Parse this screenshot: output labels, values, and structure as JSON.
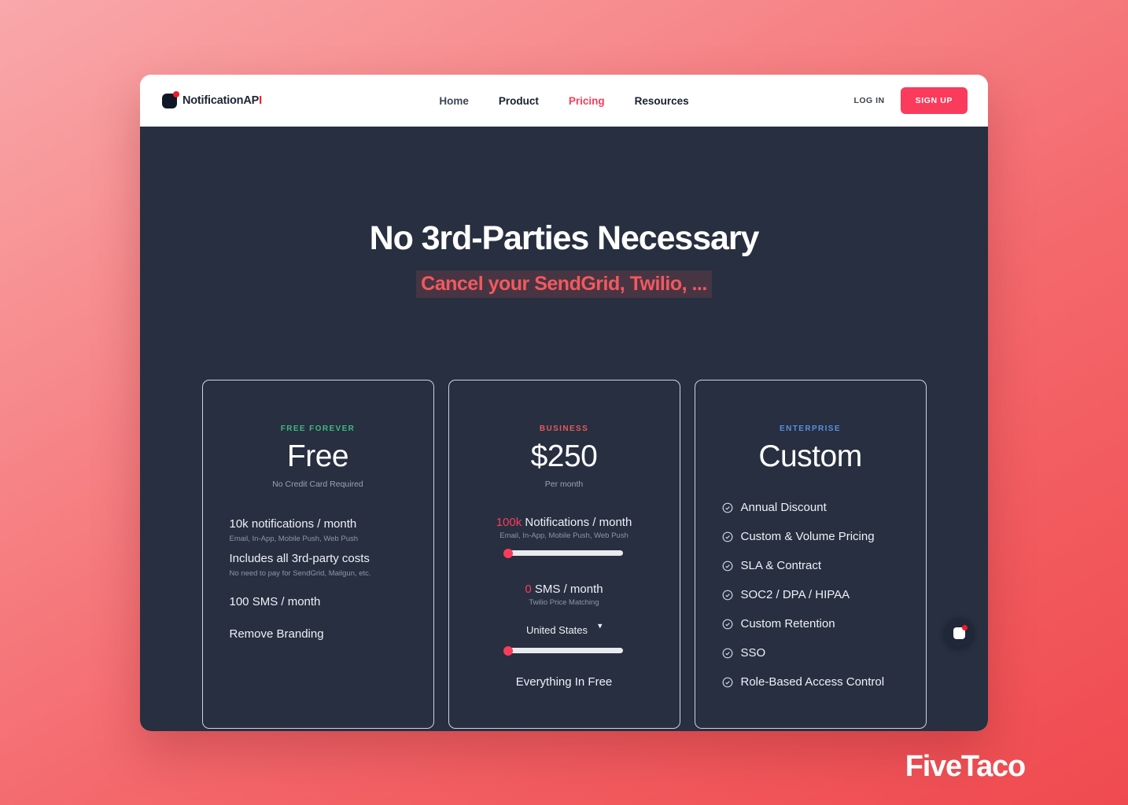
{
  "brand": {
    "name_main": "NotificationAP",
    "name_accent": "I",
    "logo_icon": "notification-square-icon"
  },
  "nav": {
    "links": [
      {
        "label": "Home",
        "state": "muted"
      },
      {
        "label": "Product",
        "state": "default"
      },
      {
        "label": "Pricing",
        "state": "active"
      },
      {
        "label": "Resources",
        "state": "default"
      }
    ],
    "login_label": "LOG IN",
    "signup_label": "SIGN UP"
  },
  "hero": {
    "title": "No 3rd-Parties Necessary",
    "subtitle": "Cancel your SendGrid, Twilio, ..."
  },
  "plans": {
    "free": {
      "tag": "FREE FOREVER",
      "price": "Free",
      "note": "No Credit Card Required",
      "features": [
        {
          "title": "10k notifications / month",
          "sub": "Email, In-App, Mobile Push, Web Push"
        },
        {
          "title": "Includes all 3rd-party costs",
          "sub": "No need to pay for SendGrid, Mailgun, etc."
        },
        {
          "title": "100 SMS / month",
          "sub": ""
        },
        {
          "title": "Remove Branding",
          "sub": ""
        }
      ]
    },
    "business": {
      "tag": "BUSINESS",
      "price": "$250",
      "note": "Per month",
      "notifications_amount": "100k",
      "notifications_label": " Notifications / month",
      "notifications_sub": "Email, In-App, Mobile Push, Web Push",
      "sms_amount": "0",
      "sms_label": " SMS / month",
      "sms_sub": "Twilio Price Matching",
      "country_selected": "United States",
      "country_options": [
        "United States"
      ],
      "footer": "Everything In Free",
      "slider_chevron": "chevron-down-icon"
    },
    "enterprise": {
      "tag": "ENTERPRISE",
      "price": "Custom",
      "features": [
        "Annual Discount",
        "Custom & Volume Pricing",
        "SLA & Contract",
        "SOC2 / DPA / HIPAA",
        "Custom Retention",
        "SSO",
        "Role-Based Access Control"
      ]
    }
  },
  "widget": {
    "icon": "notification-bell-widget-icon"
  },
  "watermark": {
    "text": "FiveTaco"
  },
  "colors": {
    "accent_pink": "#fb3b5c",
    "page_dark": "#272f40",
    "green": "#3fb980",
    "blue": "#5b8fe0",
    "red_tag": "#e45a5a"
  }
}
